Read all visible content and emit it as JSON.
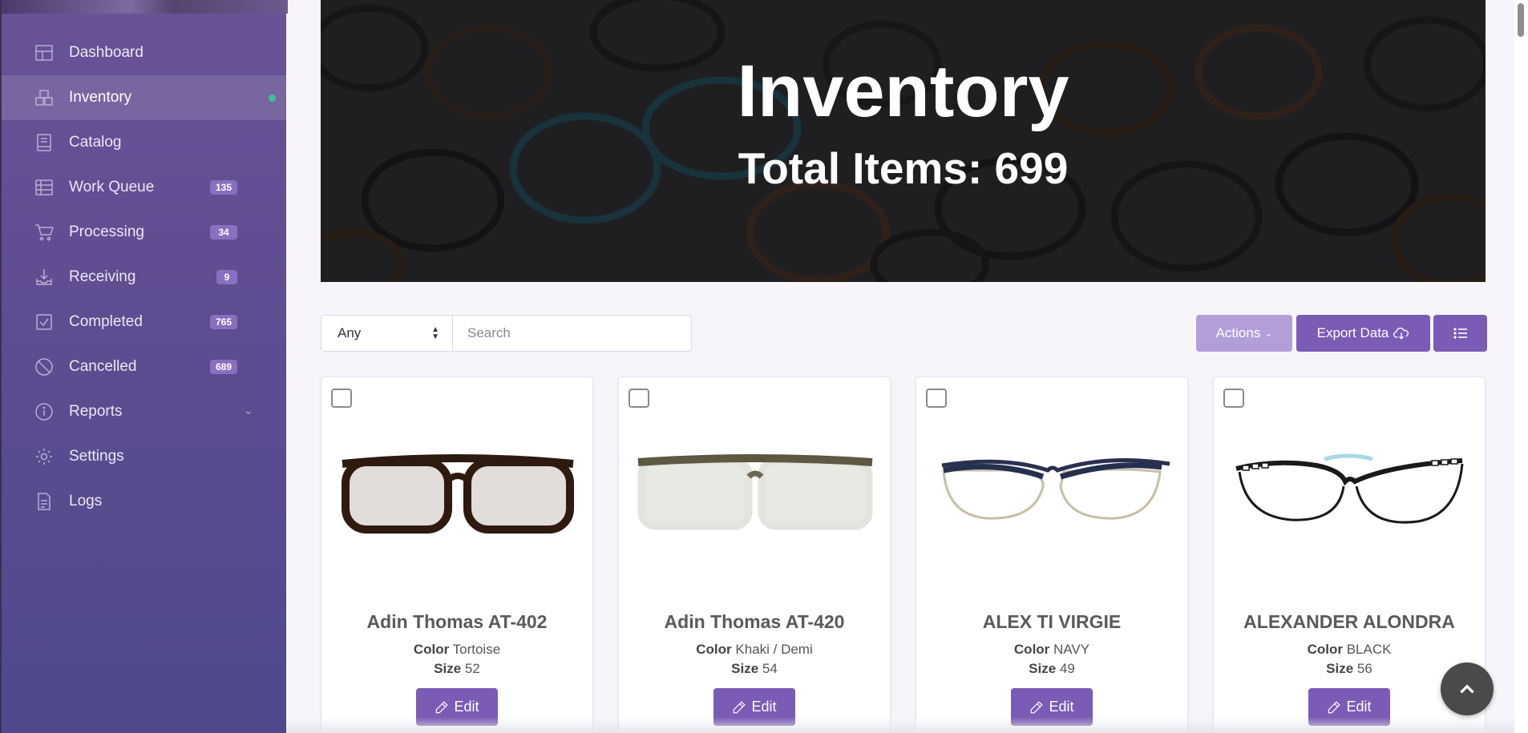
{
  "sidebar": {
    "items": [
      {
        "label": "Dashboard",
        "icon": "dashboard-icon",
        "badge": null,
        "active": false
      },
      {
        "label": "Inventory",
        "icon": "inventory-icon",
        "badge": null,
        "active": true
      },
      {
        "label": "Catalog",
        "icon": "catalog-icon",
        "badge": null,
        "active": false
      },
      {
        "label": "Work Queue",
        "icon": "work-queue-icon",
        "badge": "135",
        "active": false
      },
      {
        "label": "Processing",
        "icon": "cart-icon",
        "badge": "34",
        "active": false
      },
      {
        "label": "Receiving",
        "icon": "receiving-icon",
        "badge": "9",
        "active": false
      },
      {
        "label": "Completed",
        "icon": "check-square-icon",
        "badge": "765",
        "active": false
      },
      {
        "label": "Cancelled",
        "icon": "cancel-icon",
        "badge": "689",
        "active": false
      },
      {
        "label": "Reports",
        "icon": "info-icon",
        "badge": null,
        "active": false
      },
      {
        "label": "Settings",
        "icon": "gear-icon",
        "badge": null,
        "active": false
      },
      {
        "label": "Logs",
        "icon": "document-icon",
        "badge": null,
        "active": false
      }
    ],
    "active_indicator_color": "#39c39b"
  },
  "hero": {
    "title": "Inventory",
    "subtitle": "Total Items: 699"
  },
  "toolbar": {
    "filter_value": "Any",
    "search_placeholder": "Search",
    "actions_label": "Actions",
    "export_label": "Export Data"
  },
  "products": [
    {
      "name": "Adin Thomas AT-402",
      "color_label": "Color",
      "color": "Tortoise",
      "size_label": "Size",
      "size": "52",
      "edit_label": "Edit"
    },
    {
      "name": "Adin Thomas AT-420",
      "color_label": "Color",
      "color": "Khaki / Demi",
      "size_label": "Size",
      "size": "54",
      "edit_label": "Edit"
    },
    {
      "name": "ALEX TI VIRGIE",
      "color_label": "Color",
      "color": "NAVY",
      "size_label": "Size",
      "size": "49",
      "edit_label": "Edit"
    },
    {
      "name": "ALEXANDER ALONDRA",
      "color_label": "Color",
      "color": "BLACK",
      "size_label": "Size",
      "size": "56",
      "edit_label": "Edit"
    }
  ],
  "colors": {
    "primary": "#7a5bb5",
    "primary_light": "#b39ed8",
    "badge": "#8a6fc0"
  }
}
